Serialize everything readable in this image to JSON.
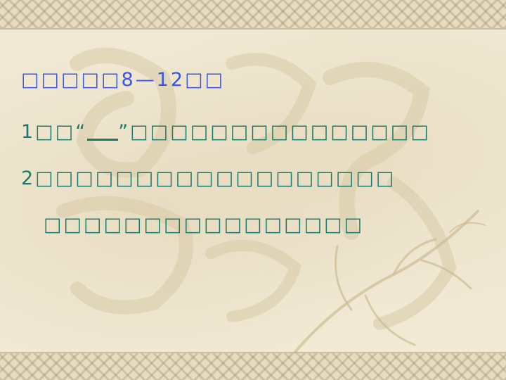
{
  "slide": {
    "title": "□□□□□8—12□□",
    "item1_prefix": "1□□“",
    "item1_suffix": "”□□□□□□□□□□□□□□□",
    "item2_line1": "2□□□□□□□□□□□□□□□□□□",
    "item2_line2": "□□□□□□□□□□□□□□□□"
  }
}
